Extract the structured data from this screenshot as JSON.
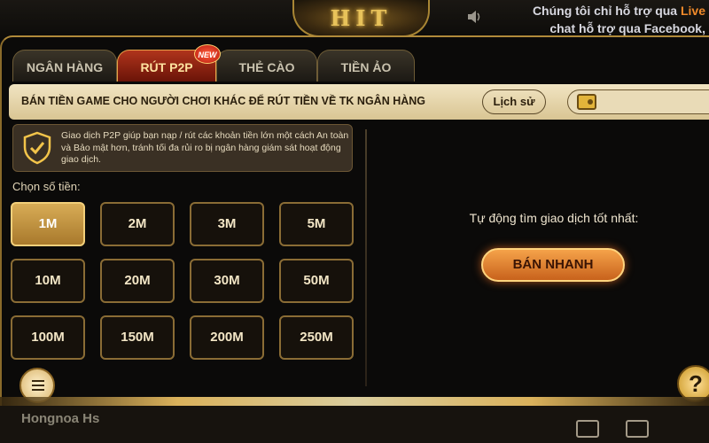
{
  "top": {
    "logo_text": "HIT",
    "marquee_line1_prefix": "Chúng tôi chỉ hỗ trợ qua ",
    "marquee_line1_live": "Live",
    "marquee_line2": "chat hỗ trợ qua Facebook, "
  },
  "tabs": [
    {
      "label": "NGÂN HÀNG"
    },
    {
      "label": "RÚT P2P"
    },
    {
      "label": "THẺ CÀO"
    },
    {
      "label": "TIỀN ẢO"
    }
  ],
  "new_badge": "NEW",
  "header": {
    "title": "BÁN TIỀN GAME CHO NGƯỜI CHƠI KHÁC ĐỂ RÚT TIỀN VỀ TK NGÂN HÀNG",
    "history_label": "Lịch sử"
  },
  "info": {
    "text": "Giao dịch P2P giúp bạn nạp / rút các khoản tiền lớn một cách An toàn và Bảo mật hơn, tránh tối đa rủi ro bị ngân hàng giám sát hoạt động giao dịch."
  },
  "amounts": {
    "label": "Chọn số tiền:",
    "options": [
      "1M",
      "2M",
      "3M",
      "5M",
      "10M",
      "20M",
      "30M",
      "50M",
      "100M",
      "150M",
      "200M",
      "250M"
    ],
    "selected": "1M"
  },
  "right": {
    "auto_text": "Tự động tìm giao dịch tốt nhất:",
    "sell_label": "BÁN NHANH"
  },
  "bottom": {
    "name": "Hongnoa Hs"
  },
  "colors": {
    "accent_gold": "#b08a3a",
    "active_tab": "#b0341c",
    "sell_button": "#f5a34a"
  }
}
